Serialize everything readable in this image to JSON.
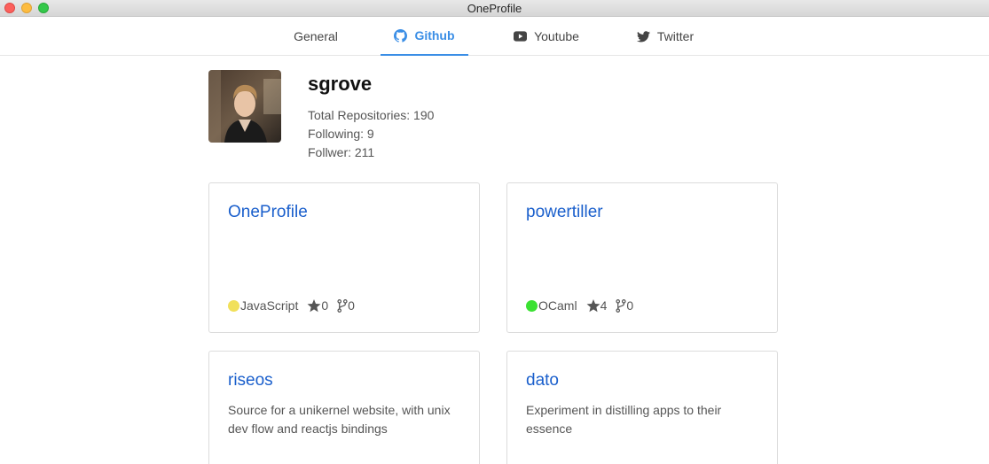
{
  "window": {
    "title": "OneProfile"
  },
  "tabs": [
    {
      "label": "General",
      "icon": "none",
      "active": false
    },
    {
      "label": "Github",
      "icon": "github-icon",
      "active": true
    },
    {
      "label": "Youtube",
      "icon": "youtube-icon",
      "active": false
    },
    {
      "label": "Twitter",
      "icon": "twitter-icon",
      "active": false
    }
  ],
  "profile": {
    "username": "sgrove",
    "total_repositories": "Total Repositories: 190",
    "following": "Following: 9",
    "followers": "Follwer: 211"
  },
  "repos": [
    {
      "name": "OneProfile",
      "description": "",
      "language": "JavaScript",
      "language_color": "#f1e05a",
      "stars": "0",
      "forks": "0"
    },
    {
      "name": "powertiller",
      "description": "",
      "language": "OCaml",
      "language_color": "#3be133",
      "stars": "4",
      "forks": "0"
    },
    {
      "name": "riseos",
      "description": "Source for a unikernel website, with unix dev flow and reactjs bindings"
    },
    {
      "name": "dato",
      "description": "Experiment in distilling apps to their essence"
    }
  ],
  "colors": {
    "accent": "#3a8ee6",
    "link": "#1a5fcc"
  }
}
